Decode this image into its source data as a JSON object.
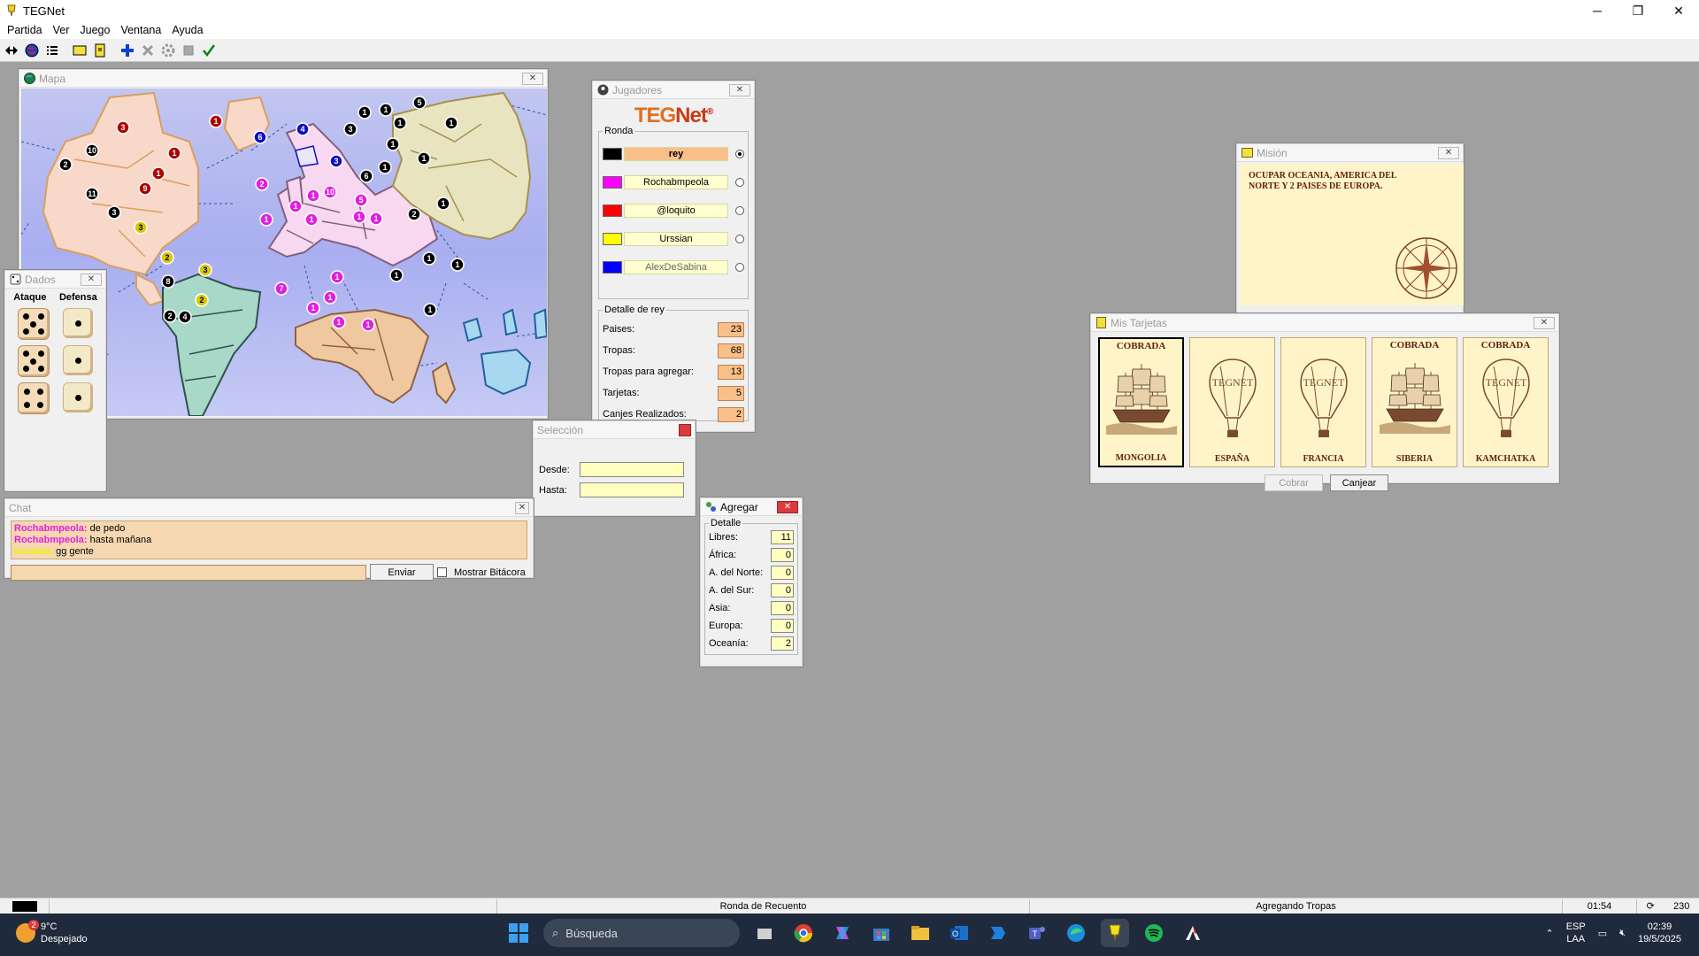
{
  "window": {
    "title": "TEGNet",
    "minimize": "─",
    "maximize": "❐",
    "close": "✕"
  },
  "menu": [
    "Partida",
    "Ver",
    "Juego",
    "Ventana",
    "Ayuda"
  ],
  "toolbar": {
    "icons": [
      "connect-icon",
      "globe-icon",
      "list-icon",
      "card-icon",
      "card-alt-icon",
      "plus-icon",
      "cross-icon",
      "gear-icon",
      "stop-icon",
      "check-icon"
    ]
  },
  "map_window": {
    "title": "Mapa",
    "armies": [
      {
        "n": "3",
        "c": "#b00000"
      },
      {
        "n": "1",
        "c": "#b00000"
      },
      {
        "n": "10",
        "c": "#000"
      },
      {
        "n": "1",
        "c": "#b00000"
      },
      {
        "n": "2",
        "c": "#000"
      },
      {
        "n": "1",
        "c": "#b00000"
      },
      {
        "n": "9",
        "c": "#b00000"
      },
      {
        "n": "11",
        "c": "#000"
      },
      {
        "n": "3",
        "c": "#000"
      },
      {
        "n": "3",
        "c": "#d8c800"
      },
      {
        "n": "6",
        "c": "#1010c0"
      },
      {
        "n": "4",
        "c": "#1010c0"
      },
      {
        "n": "3",
        "c": "#1010c0"
      },
      {
        "n": "1",
        "c": "#000"
      },
      {
        "n": "1",
        "c": "#000"
      },
      {
        "n": "5",
        "c": "#000"
      },
      {
        "n": "1",
        "c": "#000"
      },
      {
        "n": "1",
        "c": "#000"
      },
      {
        "n": "3",
        "c": "#000"
      },
      {
        "n": "1",
        "c": "#000"
      },
      {
        "n": "1",
        "c": "#000"
      },
      {
        "n": "6",
        "c": "#000"
      },
      {
        "n": "1",
        "c": "#000"
      },
      {
        "n": "2",
        "c": "#000"
      },
      {
        "n": "1",
        "c": "#000"
      },
      {
        "n": "2",
        "c": "#e020e0"
      },
      {
        "n": "1",
        "c": "#e020e0"
      },
      {
        "n": "1",
        "c": "#e020e0"
      },
      {
        "n": "10",
        "c": "#e020e0"
      },
      {
        "n": "5",
        "c": "#e020e0"
      },
      {
        "n": "1",
        "c": "#e020e0"
      },
      {
        "n": "1",
        "c": "#e020e0"
      },
      {
        "n": "1",
        "c": "#e020e0"
      },
      {
        "n": "1",
        "c": "#e020e0"
      },
      {
        "n": "2",
        "c": "#d8c800"
      },
      {
        "n": "3",
        "c": "#d8c800"
      },
      {
        "n": "8",
        "c": "#000"
      },
      {
        "n": "2",
        "c": "#d8c800"
      },
      {
        "n": "2",
        "c": "#000"
      },
      {
        "n": "4",
        "c": "#000"
      },
      {
        "n": "1",
        "c": "#e020e0"
      },
      {
        "n": "7",
        "c": "#e020e0"
      },
      {
        "n": "1",
        "c": "#e020e0"
      },
      {
        "n": "1",
        "c": "#e020e0"
      },
      {
        "n": "1",
        "c": "#e020e0"
      },
      {
        "n": "1",
        "c": "#e020e0"
      },
      {
        "n": "1",
        "c": "#000"
      },
      {
        "n": "1",
        "c": "#000"
      },
      {
        "n": "1",
        "c": "#000"
      },
      {
        "n": "1",
        "c": "#000"
      }
    ]
  },
  "dice_window": {
    "title": "Dados",
    "attack_label": "Ataque",
    "defense_label": "Defensa",
    "attack": [
      5,
      5,
      4
    ],
    "defense": [
      1,
      1,
      1
    ]
  },
  "players_window": {
    "title": "Jugadores",
    "logo_teg": "TEG",
    "logo_net": "Net",
    "logo_mark": "®",
    "round_label": "Ronda",
    "players": [
      {
        "name": "rey",
        "color": "#000000",
        "current": true,
        "selected": true,
        "dim": false
      },
      {
        "name": "Rochabmpeola",
        "color": "#ff00ff",
        "current": false,
        "selected": false,
        "dim": false
      },
      {
        "name": "@loquito",
        "color": "#ff0000",
        "current": false,
        "selected": false,
        "dim": false
      },
      {
        "name": "Urssian",
        "color": "#ffff00",
        "current": false,
        "selected": false,
        "dim": false
      },
      {
        "name": "AlexDeSabina",
        "color": "#0000ff",
        "current": false,
        "selected": false,
        "dim": true
      }
    ],
    "detail_label": "Detalle de rey",
    "detail": [
      {
        "label": "Paises:",
        "value": "23"
      },
      {
        "label": "Tropas:",
        "value": "68"
      },
      {
        "label": "Tropas para agregar:",
        "value": "13"
      },
      {
        "label": "Tarjetas:",
        "value": "5"
      },
      {
        "label": "Canjes Realizados:",
        "value": "2"
      }
    ]
  },
  "selection_window": {
    "title": "Selección",
    "from_label": "Desde:",
    "to_label": "Hasta:",
    "from_value": "",
    "to_value": ""
  },
  "chat_window": {
    "title": "Chat",
    "messages": [
      {
        "nick": "Rochabmpeola",
        "sep": ":",
        "text": " de pedo",
        "color": "m"
      },
      {
        "nick": "Rochabmpeola",
        "sep": ":",
        "text": " hasta mañana",
        "color": "m"
      },
      {
        "nick": "Urssian",
        "sep": ":",
        "text": " gg gente",
        "color": "y"
      }
    ],
    "send_label": "Enviar",
    "log_label": "Mostrar Bitácora",
    "input_value": ""
  },
  "add_window": {
    "title": "Agregar",
    "detail_label": "Detalle",
    "rows": [
      {
        "label": "Libres:",
        "value": "11"
      },
      {
        "label": "África:",
        "value": "0"
      },
      {
        "label": "A. del Norte:",
        "value": "0"
      },
      {
        "label": "A. del Sur:",
        "value": "0"
      },
      {
        "label": "Asia:",
        "value": "0"
      },
      {
        "label": "Europa:",
        "value": "0"
      },
      {
        "label": "Oceanía:",
        "value": "2"
      }
    ]
  },
  "mission_window": {
    "title": "Misión",
    "text": "OCUPAR OCEANIA, AMERICA DEL NORTE Y 2 PAISES DE EUROPA."
  },
  "cards_window": {
    "title": "Mis Tarjetas",
    "cards": [
      {
        "name": "MONGOLIA",
        "status": "COBRADA",
        "art": "ship",
        "selected": true
      },
      {
        "name": "ESPAÑA",
        "status": "",
        "art": "balloon",
        "selected": false
      },
      {
        "name": "FRANCIA",
        "status": "",
        "art": "balloon",
        "selected": false
      },
      {
        "name": "SIBERIA",
        "status": "COBRADA",
        "art": "ship",
        "selected": false
      },
      {
        "name": "KAMCHATKA",
        "status": "COBRADA",
        "art": "balloon",
        "selected": false
      }
    ],
    "balloon_text": "TEGNET",
    "collect_label": "Cobrar",
    "exchange_label": "Canjear"
  },
  "statusbar": {
    "color": "#000000",
    "round": "Ronda de Recuento",
    "state": "Agregando Tropas",
    "time": "01:54",
    "count": "230"
  },
  "taskbar": {
    "temperature": "9°C",
    "weather": "Despejado",
    "weather_badge": "2",
    "search": "Búsqueda",
    "lang": "ESP",
    "lang2": "LAA",
    "time": "02:39",
    "date": "19/5/2025"
  },
  "colors": {
    "accent": "#f8c088",
    "yellow_field": "#ffffc0",
    "map_sea": "#aab0f0"
  }
}
